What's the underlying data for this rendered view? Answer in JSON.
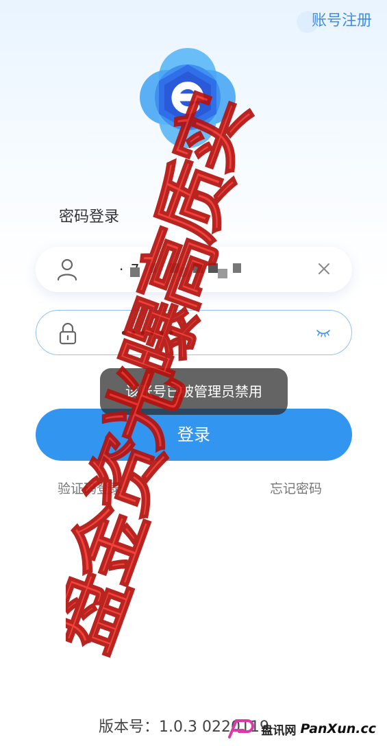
{
  "header": {
    "register_label": "账号注册"
  },
  "logo": {
    "letter": "e",
    "icon": "app-logo-e-icon"
  },
  "login_mode_title": "密码登录",
  "username": {
    "icon": "user-icon",
    "value": "·  7",
    "clear_icon": "close-icon"
  },
  "password": {
    "icon": "lock-icon",
    "value": "••••••",
    "toggle_icon": "eye-closed-icon"
  },
  "toast": {
    "message": "该账号已被管理员禁用"
  },
  "login_button_label": "登录",
  "links": {
    "sms_login": "验证码登录",
    "forgot_password": "忘记密码"
  },
  "watermark": {
    "text": "实质高曝光资金盘辨识"
  },
  "footer": {
    "version": "版本号：1.0.3 0220119"
  },
  "brand_badge": {
    "cn": "盘讯网",
    "en": "PanXun.cc"
  },
  "colors": {
    "accent": "#3296f1",
    "watermark_red": "#f2322c",
    "logo_blue": "#2f6fe8"
  }
}
